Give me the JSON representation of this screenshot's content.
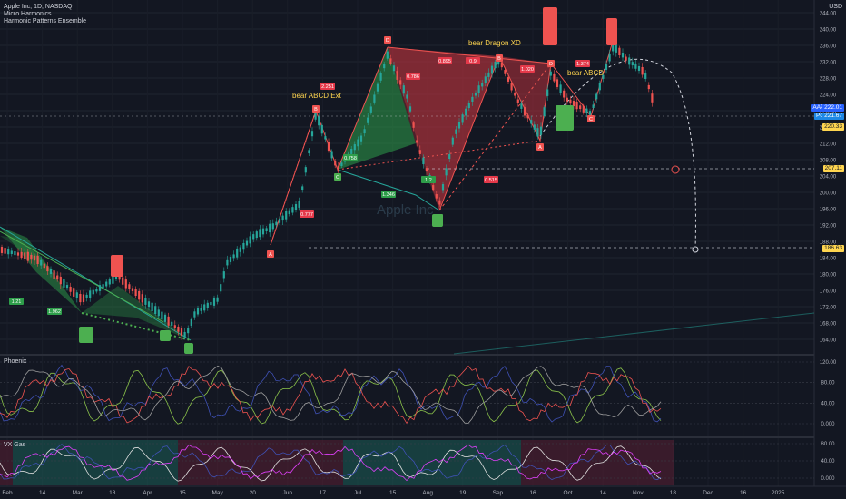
{
  "header": {
    "symbol_line": "Apple Inc, 1D, NASDAQ",
    "indicator1": "Micro Harmonics",
    "indicator2": "Harmonic Patterns Ensemble",
    "currency": "USD"
  },
  "watermark": "Apple Inc",
  "pattern_labels": {
    "abcd_ext": "bear ABCD Ext",
    "dragon": "bear Dragon XD",
    "abcd": "bear ABCD"
  },
  "ratios": [
    "1.21",
    "1.962",
    "0.777",
    "2.251",
    "0.758",
    "1.346",
    "0.895",
    "0.9",
    "1.020",
    "1.374",
    "0.515",
    "1.2",
    "0.786"
  ],
  "points": {
    "A": "A",
    "B": "B",
    "C": "C",
    "D": "D",
    "X": "X"
  },
  "price_axis": {
    "ticks": [
      "244.00",
      "240.00",
      "236.00",
      "232.00",
      "228.00",
      "224.00",
      "220.00",
      "216.00",
      "212.00",
      "208.00",
      "204.00",
      "200.00",
      "196.00",
      "192.00",
      "188.00",
      "184.00",
      "180.00",
      "176.00",
      "172.00",
      "168.00",
      "164.00"
    ],
    "tags": {
      "aapl": "AAPL",
      "aapl_val": "222.01",
      "post": "Post",
      "post_val": "221.67",
      "last": "220.33",
      "level1": "207.11",
      "level2": "186.63"
    }
  },
  "pane2": {
    "title": "Phoenix",
    "ticks": [
      "120.00",
      "80.00",
      "40.00",
      "0.000"
    ]
  },
  "pane3": {
    "title": "VX Gas",
    "ticks": [
      "80.00",
      "40.00",
      "0.000"
    ]
  },
  "time_axis": [
    "Feb",
    "14",
    "Mar",
    "18",
    "Apr",
    "15",
    "May",
    "20",
    "Jun",
    "17",
    "Jul",
    "15",
    "Aug",
    "19",
    "Sep",
    "16",
    "Oct",
    "14",
    "Nov",
    "18",
    "Dec",
    "16",
    "2025"
  ],
  "colors": {
    "bg": "#131722",
    "up": "#26a69a",
    "down": "#ef5350",
    "bear_fill": "#b7323d",
    "bull_fill": "#2e9e4a"
  },
  "chart_data": {
    "type": "candlestick",
    "title": "",
    "x": [
      "Feb",
      "Mar",
      "Apr",
      "May",
      "Jun",
      "Jul",
      "Aug",
      "Sep",
      "Oct",
      "Nov"
    ],
    "close_approx": [
      185,
      172,
      170,
      190,
      212,
      226,
      215,
      222,
      232,
      222
    ],
    "ylim": [
      162,
      246
    ]
  }
}
